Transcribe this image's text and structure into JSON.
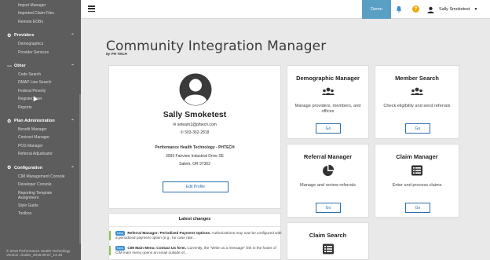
{
  "sidebar": {
    "top_items": [
      "Import Manager",
      "Imported Claim Files",
      "Remote EOBs"
    ],
    "sections": [
      {
        "label": "Providers",
        "items": [
          "Demographics",
          "Provider Services"
        ]
      },
      {
        "label": "Other",
        "items": [
          "Code Search",
          "DMAP Line Search",
          "Federal Poverty",
          "Register User",
          "Reports"
        ]
      },
      {
        "label": "Plan Administration",
        "items": [
          "Benefit Manager",
          "Contract Manager",
          "POS Manager",
          "Referral Adjudicator"
        ]
      },
      {
        "label": "Configuration",
        "items": [
          "CIM Management Console",
          "Developer Console",
          "Reporting Template Assignment",
          "Style Guide",
          "Toolbox"
        ]
      }
    ],
    "footer_copyright": "© 2018 Performance Health Technology",
    "footer_version": "Version: cluster_2018.08.07_14.48"
  },
  "topbar": {
    "demo_label": "Demo",
    "user_name": "Sally Smoketest"
  },
  "page": {
    "title": "Community Integration Manager",
    "subtitle": "by PH TECH"
  },
  "profile": {
    "name": "Sally Smoketest",
    "email": "seteam1@phtech.com",
    "phone": "503-362-2818",
    "org": "Performance Health Technology - PHTECH",
    "address1": "3993 Fairview Industrial Drive SE",
    "address2": "Salem, OR 97302",
    "edit_label": "Edit Profile"
  },
  "changes": {
    "heading": "Latest changes",
    "items": [
      {
        "badge": "New",
        "title": "Referral Manager: Periodized Payment Options.",
        "text": "Authorizations may now be configured with a periodized payment option (e.g., for case rate...",
        "more": ""
      },
      {
        "badge": "New",
        "title": "CIM Main Menu: Contact Us form.",
        "text": "Currently, the \"Write us a message\" link in the footer of CIM main menu opens an email outside of...",
        "more": ""
      }
    ]
  },
  "tiles": [
    {
      "title": "Demographic Manager",
      "desc": "Manage providers, members, and offices",
      "go": "Go",
      "icon": "people-icon"
    },
    {
      "title": "Member Search",
      "desc": "Check eligibility and send referrals",
      "go": "Go",
      "icon": "people-icon"
    },
    {
      "title": "Referral Manager",
      "desc": "Manage and review referrals",
      "go": "Go",
      "icon": "pie-chart-icon"
    },
    {
      "title": "Claim Manager",
      "desc": "Enter and process claims",
      "go": "Go",
      "icon": "list-icon"
    },
    {
      "title": "Claim Search",
      "icon": "list-icon"
    }
  ]
}
